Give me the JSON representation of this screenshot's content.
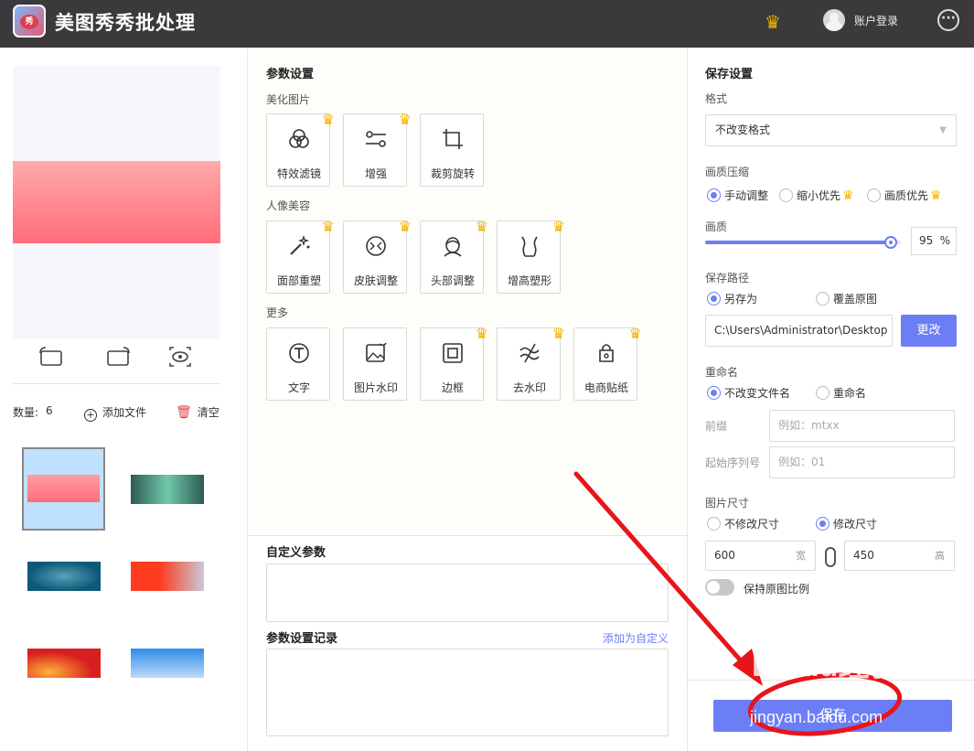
{
  "app": {
    "title": "美图秀秀批处理",
    "login": "账户登录"
  },
  "left": {
    "count_label": "数量:",
    "count_value": "6",
    "add_file": "添加文件",
    "clear": "清空"
  },
  "middle": {
    "params_title": "参数设置",
    "group_beautify": "美化图片",
    "group_portrait": "人像美容",
    "group_more": "更多",
    "tools_beautify": [
      {
        "label": "特效滤镜",
        "icon": "filter-icon",
        "vip": true
      },
      {
        "label": "增强",
        "icon": "sliders-icon",
        "vip": true
      },
      {
        "label": "裁剪旋转",
        "icon": "crop-icon",
        "vip": false
      }
    ],
    "tools_portrait": [
      {
        "label": "面部重塑",
        "icon": "magic-wand-icon",
        "vip": true
      },
      {
        "label": "皮肤调整",
        "icon": "skin-icon",
        "vip": true
      },
      {
        "label": "头部调整",
        "icon": "head-icon",
        "vip": true
      },
      {
        "label": "增高塑形",
        "icon": "body-shape-icon",
        "vip": true
      }
    ],
    "tools_more": [
      {
        "label": "文字",
        "icon": "text-icon",
        "vip": false
      },
      {
        "label": "图片水印",
        "icon": "image-watermark-icon",
        "vip": false
      },
      {
        "label": "边框",
        "icon": "border-icon",
        "vip": true
      },
      {
        "label": "去水印",
        "icon": "remove-watermark-icon",
        "vip": true
      },
      {
        "label": "电商贴纸",
        "icon": "sticker-icon",
        "vip": true
      }
    ],
    "custom_params_title": "自定义参数",
    "history_title": "参数设置记录",
    "add_custom_link": "添加为自定义"
  },
  "right": {
    "save_title": "保存设置",
    "format_label": "格式",
    "format_value": "不改变格式",
    "compress_label": "画质压缩",
    "compress_options": [
      "手动调整",
      "缩小优先",
      "画质优先"
    ],
    "quality_label": "画质",
    "quality_value": "95",
    "quality_unit": "%",
    "path_label": "保存路径",
    "path_options": [
      "另存为",
      "覆盖原图"
    ],
    "path_value": "C:\\Users\\Administrator\\Desktop",
    "change_button": "更改",
    "rename_label": "重命名",
    "rename_options": [
      "不改变文件名",
      "重命名"
    ],
    "prefix_label": "前缀",
    "prefix_placeholder": "例如：mtxx",
    "seq_label": "起始序列号",
    "seq_placeholder": "例如：01",
    "size_label": "图片尺寸",
    "size_options": [
      "不修改尺寸",
      "修改尺寸"
    ],
    "width_value": "600",
    "width_unit": "宽",
    "height_value": "450",
    "height_unit": "高",
    "keep_ratio": "保持原图比例",
    "save_button": "保存"
  },
  "watermark": {
    "line1": "Baidu经验",
    "line2": "jingyan.baidu.com"
  },
  "colors": {
    "accent": "#6c7ef5",
    "crown": "#f5b400",
    "titlebar": "#3a3a3c",
    "annotation": "#e8141b"
  }
}
